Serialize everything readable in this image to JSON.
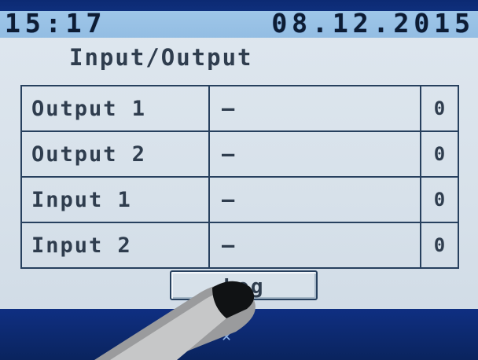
{
  "status_bar": {
    "time": "15:17",
    "date": "08.12.2015"
  },
  "page": {
    "title": "Input/Output"
  },
  "io_table": {
    "rows": [
      {
        "name": "Output 1",
        "state": "—",
        "count": "0"
      },
      {
        "name": "Output 2",
        "state": "—",
        "count": "0"
      },
      {
        "name": "Input 1",
        "state": "—",
        "count": "0"
      },
      {
        "name": "Input 2",
        "state": "—",
        "count": "0"
      }
    ]
  },
  "actions": {
    "log_label": "Log"
  },
  "colors": {
    "header_blue": "#153c93",
    "panel_bg": "#d7e1ea",
    "text_dark": "#2f3d4e",
    "grid_line": "#27405e"
  }
}
